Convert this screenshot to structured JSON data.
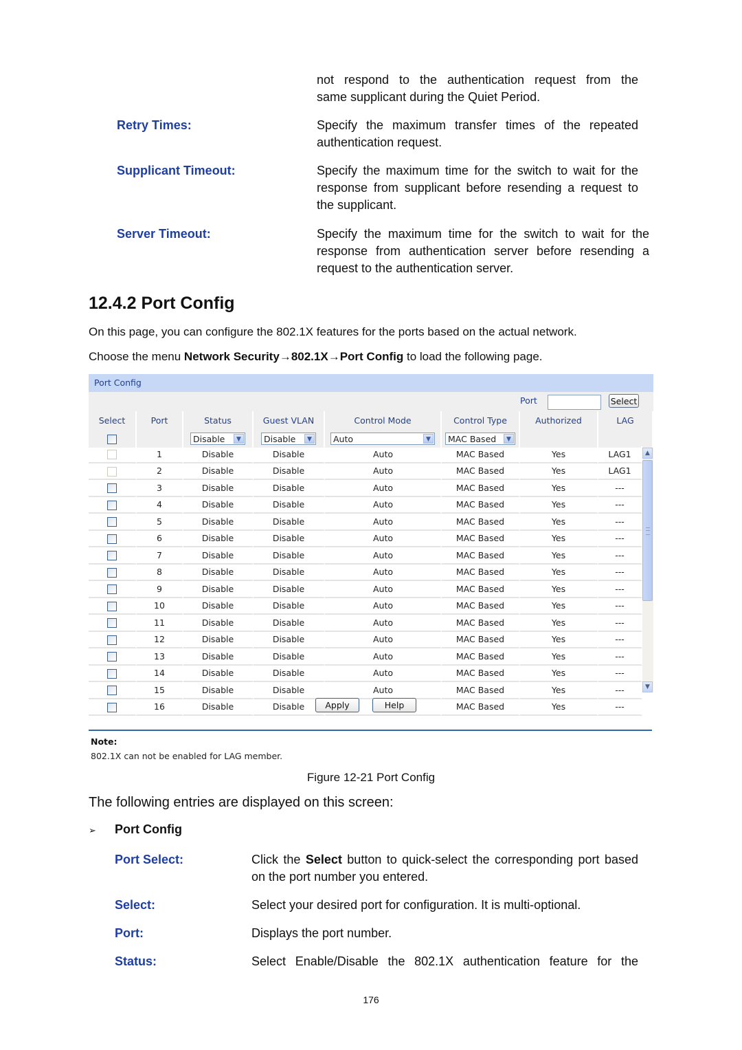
{
  "top_entries": {
    "cont_line1": "not respond to the authentication request from the",
    "cont_line2": "same supplicant during the Quiet Period.",
    "items": [
      {
        "term": "Retry Times:",
        "desc": "Specify the maximum transfer times of the repeated authentication request."
      },
      {
        "term": "Supplicant Timeout:",
        "desc": "Specify the maximum time for the switch to wait for the response from supplicant before resending a request to the supplicant."
      },
      {
        "term": "Server Timeout:",
        "desc": "Specify the maximum time for the switch to wait for the response from authentication server before resending a request to the authentication server."
      }
    ]
  },
  "section": {
    "heading": "12.4.2  Port Config",
    "intro": "On this page, you can configure the 802.1X features for the ports based on the actual network.",
    "menu_prefix": "Choose the menu ",
    "menu_path_1": "Network Security",
    "arrow": "→",
    "menu_path_2": "802.1X",
    "menu_path_3": "Port Config",
    "menu_suffix": " to load the following page."
  },
  "ui": {
    "panel_title": "Port Config",
    "port_label": "Port",
    "port_input_value": "",
    "select_button": "Select",
    "columns": [
      "Select",
      "Port",
      "Status",
      "Guest VLAN",
      "Control Mode",
      "Control Type",
      "Authorized",
      "LAG"
    ],
    "controls": {
      "status": "Disable",
      "guest_vlan": "Disable",
      "control_mode": "Auto",
      "control_type": "MAC Based"
    },
    "rows": [
      {
        "port": "1",
        "status": "Disable",
        "guest_vlan": "Disable",
        "mode": "Auto",
        "type": "MAC Based",
        "authorized": "Yes",
        "lag": "LAG1",
        "disabled": true
      },
      {
        "port": "2",
        "status": "Disable",
        "guest_vlan": "Disable",
        "mode": "Auto",
        "type": "MAC Based",
        "authorized": "Yes",
        "lag": "LAG1",
        "disabled": true
      },
      {
        "port": "3",
        "status": "Disable",
        "guest_vlan": "Disable",
        "mode": "Auto",
        "type": "MAC Based",
        "authorized": "Yes",
        "lag": "---",
        "disabled": false
      },
      {
        "port": "4",
        "status": "Disable",
        "guest_vlan": "Disable",
        "mode": "Auto",
        "type": "MAC Based",
        "authorized": "Yes",
        "lag": "---",
        "disabled": false
      },
      {
        "port": "5",
        "status": "Disable",
        "guest_vlan": "Disable",
        "mode": "Auto",
        "type": "MAC Based",
        "authorized": "Yes",
        "lag": "---",
        "disabled": false
      },
      {
        "port": "6",
        "status": "Disable",
        "guest_vlan": "Disable",
        "mode": "Auto",
        "type": "MAC Based",
        "authorized": "Yes",
        "lag": "---",
        "disabled": false
      },
      {
        "port": "7",
        "status": "Disable",
        "guest_vlan": "Disable",
        "mode": "Auto",
        "type": "MAC Based",
        "authorized": "Yes",
        "lag": "---",
        "disabled": false
      },
      {
        "port": "8",
        "status": "Disable",
        "guest_vlan": "Disable",
        "mode": "Auto",
        "type": "MAC Based",
        "authorized": "Yes",
        "lag": "---",
        "disabled": false
      },
      {
        "port": "9",
        "status": "Disable",
        "guest_vlan": "Disable",
        "mode": "Auto",
        "type": "MAC Based",
        "authorized": "Yes",
        "lag": "---",
        "disabled": false
      },
      {
        "port": "10",
        "status": "Disable",
        "guest_vlan": "Disable",
        "mode": "Auto",
        "type": "MAC Based",
        "authorized": "Yes",
        "lag": "---",
        "disabled": false
      },
      {
        "port": "11",
        "status": "Disable",
        "guest_vlan": "Disable",
        "mode": "Auto",
        "type": "MAC Based",
        "authorized": "Yes",
        "lag": "---",
        "disabled": false
      },
      {
        "port": "12",
        "status": "Disable",
        "guest_vlan": "Disable",
        "mode": "Auto",
        "type": "MAC Based",
        "authorized": "Yes",
        "lag": "---",
        "disabled": false
      },
      {
        "port": "13",
        "status": "Disable",
        "guest_vlan": "Disable",
        "mode": "Auto",
        "type": "MAC Based",
        "authorized": "Yes",
        "lag": "---",
        "disabled": false
      },
      {
        "port": "14",
        "status": "Disable",
        "guest_vlan": "Disable",
        "mode": "Auto",
        "type": "MAC Based",
        "authorized": "Yes",
        "lag": "---",
        "disabled": false
      },
      {
        "port": "15",
        "status": "Disable",
        "guest_vlan": "Disable",
        "mode": "Auto",
        "type": "MAC Based",
        "authorized": "Yes",
        "lag": "---",
        "disabled": false
      },
      {
        "port": "16",
        "status": "Disable",
        "guest_vlan": "Disable",
        "mode": "Auto",
        "type": "MAC Based",
        "authorized": "Yes",
        "lag": "---",
        "disabled": false
      }
    ],
    "apply_button": "Apply",
    "help_button": "Help",
    "note_heading": "Note:",
    "note_text": "802.1X can not be enabled for LAG member."
  },
  "figure_caption": "Figure 12-21 Port Config",
  "entries_intro": "The following entries are displayed on this screen:",
  "bullet": {
    "marker": "➢",
    "label": "Port Config"
  },
  "bottom_entries": {
    "port_select_term": "Port Select:",
    "port_select_desc_a": "Click the ",
    "port_select_desc_bold": "Select",
    "port_select_desc_b": " button to quick-select the corresponding port based on the port number you entered.",
    "items": [
      {
        "term": "Select:",
        "desc": "Select your desired port for configuration. It is multi-optional."
      },
      {
        "term": "Port:",
        "desc": "Displays the port number."
      },
      {
        "term": "Status:",
        "desc": "Select Enable/Disable the 802.1X authentication feature for the"
      }
    ]
  },
  "page_number": "176"
}
